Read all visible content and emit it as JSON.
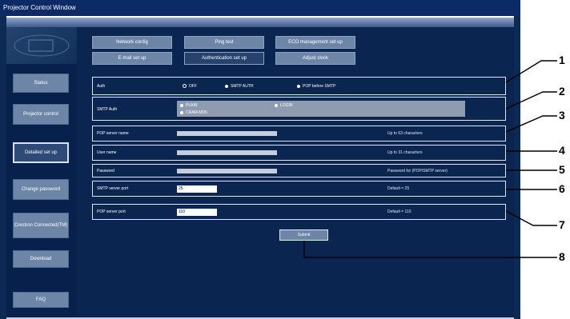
{
  "window": {
    "title": "Projector Control Window"
  },
  "sidebar": {
    "items": [
      {
        "label": "Status"
      },
      {
        "label": "Projector control"
      },
      {
        "label": "Detailed set up"
      },
      {
        "label": "Change password"
      },
      {
        "label": "Crestron Connected(TM)"
      },
      {
        "label": "Download"
      },
      {
        "label": "FAQ"
      }
    ]
  },
  "tabs": {
    "row1": [
      "Network config",
      "Ping test",
      "ECO management set up"
    ],
    "row2": [
      "E-mail set up",
      "Authentication set up",
      "Adjust clock"
    ]
  },
  "form": {
    "auth": {
      "label": "Auth",
      "options": [
        "OFF",
        "SMTP AUTH",
        "POP before SMTP"
      ]
    },
    "smtp_auth": {
      "label": "SMTP Auth",
      "options": [
        "PLAIN",
        "LOGIN",
        "CRAM-MD5"
      ]
    },
    "pop_server": {
      "label": "POP server name",
      "note": "Up to 63 characters"
    },
    "user_name": {
      "label": "User name",
      "note": "Up to 31 characters"
    },
    "password": {
      "label": "Password",
      "note": "Password for (POP/SMTP server)"
    },
    "smtp_port": {
      "label": "SMTP server port",
      "value": "25",
      "note": "Default = 25"
    },
    "pop_port": {
      "label": "POP server port",
      "value": "110",
      "note": "Default = 110"
    }
  },
  "submit_label": "Submit",
  "callouts": [
    "1",
    "2",
    "3",
    "4",
    "5",
    "6",
    "7",
    "8"
  ]
}
